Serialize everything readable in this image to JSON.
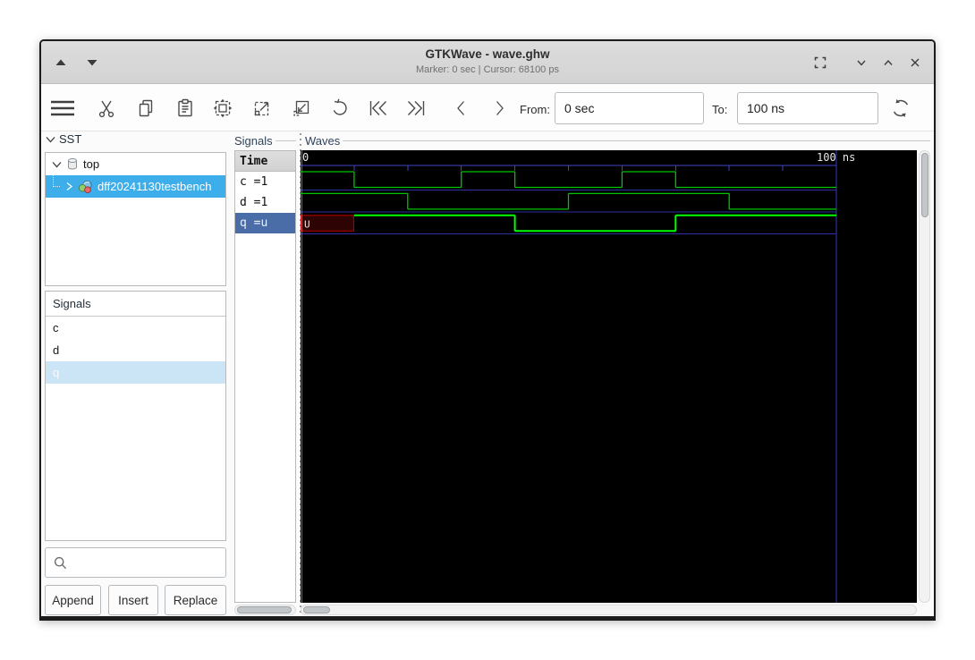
{
  "window": {
    "title": "GTKWave - wave.ghw",
    "subtitle": "Marker: 0 sec  |  Cursor: 68100 ps"
  },
  "toolbar": {
    "icons": [
      "menu",
      "cut",
      "copy",
      "paste",
      "zoom-fit",
      "zoom-in",
      "zoom-out",
      "undo",
      "skip-to-start",
      "skip-to-end",
      "step-left",
      "step-right",
      "reload"
    ],
    "from_label": "From:",
    "from_value": "0 sec",
    "to_label": "To:",
    "to_value": "100 ns"
  },
  "sst": {
    "label": "SST",
    "root_label": "top",
    "child_label": "dff20241130testbench"
  },
  "signal_values": {
    "label": "Signals",
    "time_header": "Time",
    "rows": [
      {
        "label": "c =1",
        "selected": false
      },
      {
        "label": "d =1",
        "selected": false
      },
      {
        "label": "q =u",
        "selected": true
      }
    ]
  },
  "signal_search": {
    "label": "Signals",
    "items": [
      {
        "label": "c",
        "selected": false
      },
      {
        "label": "d",
        "selected": false
      },
      {
        "label": "q",
        "selected": true
      }
    ],
    "search_placeholder": "",
    "buttons": [
      {
        "label": "Append"
      },
      {
        "label": "Insert"
      },
      {
        "label": "Replace"
      }
    ]
  },
  "waves": {
    "label": "Waves",
    "start_label": "0",
    "end_label": "100 ns",
    "time_end_ns": 100,
    "tick_ns": 10,
    "signals": [
      {
        "name": "c",
        "selected": false,
        "segments": [
          [
            0,
            10,
            "1"
          ],
          [
            10,
            30,
            "0"
          ],
          [
            30,
            40,
            "1"
          ],
          [
            40,
            60,
            "0"
          ],
          [
            60,
            70,
            "1"
          ],
          [
            70,
            100,
            "0"
          ]
        ]
      },
      {
        "name": "d",
        "selected": false,
        "segments": [
          [
            0,
            20,
            "1"
          ],
          [
            20,
            50,
            "0"
          ],
          [
            50,
            80,
            "1"
          ],
          [
            80,
            100,
            "0"
          ]
        ]
      },
      {
        "name": "q",
        "selected": true,
        "segments": [
          [
            0,
            10,
            "U"
          ],
          [
            10,
            40,
            "1"
          ],
          [
            40,
            70,
            "0"
          ],
          [
            70,
            100,
            "1"
          ]
        ]
      }
    ],
    "colors": {
      "background": "#000000",
      "wave": "#00c400",
      "wave_selected": "#00ff00",
      "timeline": "#4242c8",
      "separator": "#3030a0",
      "end_line": "#3a3ab8",
      "marker": "#d04848",
      "undef_fill": "#2e0303",
      "undef_border": "#c00000",
      "label_text": "#e8e8e8"
    }
  },
  "colors": {
    "selection_blue": "#3daee9",
    "selection_dark": "#4a6da8",
    "selection_light": "#cbe5f6"
  }
}
